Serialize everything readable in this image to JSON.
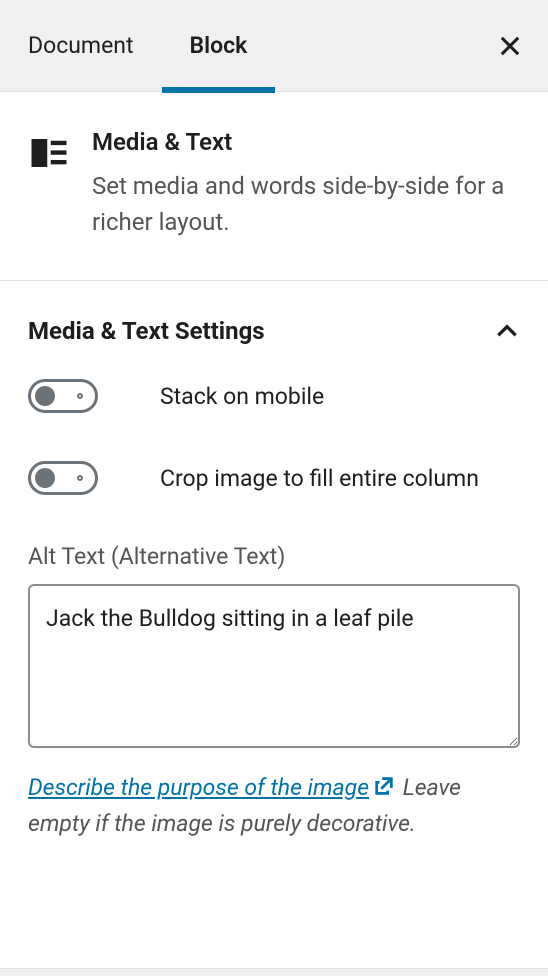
{
  "tabs": {
    "document": "Document",
    "block": "Block"
  },
  "block": {
    "title": "Media & Text",
    "description": "Set media and words side-by-side for a richer layout."
  },
  "settings": {
    "heading": "Media & Text Settings",
    "stack_on_mobile": {
      "label": "Stack on mobile",
      "value": false
    },
    "crop_image": {
      "label": "Crop image to fill entire column",
      "value": false
    },
    "alt_text": {
      "label": "Alt Text (Alternative Text)",
      "value": "Jack the Bulldog sitting in a leaf pile",
      "help_link": "Describe the purpose of the image",
      "help_rest": "Leave empty if the image is purely decorative."
    }
  }
}
